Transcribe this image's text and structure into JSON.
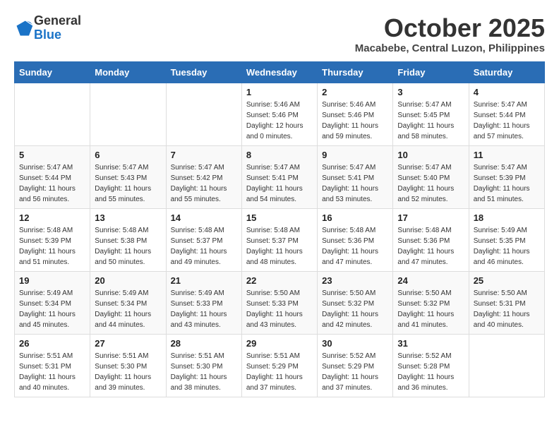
{
  "logo": {
    "general": "General",
    "blue": "Blue"
  },
  "title": "October 2025",
  "subtitle": "Macabebe, Central Luzon, Philippines",
  "weekdays": [
    "Sunday",
    "Monday",
    "Tuesday",
    "Wednesday",
    "Thursday",
    "Friday",
    "Saturday"
  ],
  "weeks": [
    [
      {
        "day": "",
        "info": ""
      },
      {
        "day": "",
        "info": ""
      },
      {
        "day": "",
        "info": ""
      },
      {
        "day": "1",
        "info": "Sunrise: 5:46 AM\nSunset: 5:46 PM\nDaylight: 12 hours\nand 0 minutes."
      },
      {
        "day": "2",
        "info": "Sunrise: 5:46 AM\nSunset: 5:46 PM\nDaylight: 11 hours\nand 59 minutes."
      },
      {
        "day": "3",
        "info": "Sunrise: 5:47 AM\nSunset: 5:45 PM\nDaylight: 11 hours\nand 58 minutes."
      },
      {
        "day": "4",
        "info": "Sunrise: 5:47 AM\nSunset: 5:44 PM\nDaylight: 11 hours\nand 57 minutes."
      }
    ],
    [
      {
        "day": "5",
        "info": "Sunrise: 5:47 AM\nSunset: 5:44 PM\nDaylight: 11 hours\nand 56 minutes."
      },
      {
        "day": "6",
        "info": "Sunrise: 5:47 AM\nSunset: 5:43 PM\nDaylight: 11 hours\nand 55 minutes."
      },
      {
        "day": "7",
        "info": "Sunrise: 5:47 AM\nSunset: 5:42 PM\nDaylight: 11 hours\nand 55 minutes."
      },
      {
        "day": "8",
        "info": "Sunrise: 5:47 AM\nSunset: 5:41 PM\nDaylight: 11 hours\nand 54 minutes."
      },
      {
        "day": "9",
        "info": "Sunrise: 5:47 AM\nSunset: 5:41 PM\nDaylight: 11 hours\nand 53 minutes."
      },
      {
        "day": "10",
        "info": "Sunrise: 5:47 AM\nSunset: 5:40 PM\nDaylight: 11 hours\nand 52 minutes."
      },
      {
        "day": "11",
        "info": "Sunrise: 5:47 AM\nSunset: 5:39 PM\nDaylight: 11 hours\nand 51 minutes."
      }
    ],
    [
      {
        "day": "12",
        "info": "Sunrise: 5:48 AM\nSunset: 5:39 PM\nDaylight: 11 hours\nand 51 minutes."
      },
      {
        "day": "13",
        "info": "Sunrise: 5:48 AM\nSunset: 5:38 PM\nDaylight: 11 hours\nand 50 minutes."
      },
      {
        "day": "14",
        "info": "Sunrise: 5:48 AM\nSunset: 5:37 PM\nDaylight: 11 hours\nand 49 minutes."
      },
      {
        "day": "15",
        "info": "Sunrise: 5:48 AM\nSunset: 5:37 PM\nDaylight: 11 hours\nand 48 minutes."
      },
      {
        "day": "16",
        "info": "Sunrise: 5:48 AM\nSunset: 5:36 PM\nDaylight: 11 hours\nand 47 minutes."
      },
      {
        "day": "17",
        "info": "Sunrise: 5:48 AM\nSunset: 5:36 PM\nDaylight: 11 hours\nand 47 minutes."
      },
      {
        "day": "18",
        "info": "Sunrise: 5:49 AM\nSunset: 5:35 PM\nDaylight: 11 hours\nand 46 minutes."
      }
    ],
    [
      {
        "day": "19",
        "info": "Sunrise: 5:49 AM\nSunset: 5:34 PM\nDaylight: 11 hours\nand 45 minutes."
      },
      {
        "day": "20",
        "info": "Sunrise: 5:49 AM\nSunset: 5:34 PM\nDaylight: 11 hours\nand 44 minutes."
      },
      {
        "day": "21",
        "info": "Sunrise: 5:49 AM\nSunset: 5:33 PM\nDaylight: 11 hours\nand 43 minutes."
      },
      {
        "day": "22",
        "info": "Sunrise: 5:50 AM\nSunset: 5:33 PM\nDaylight: 11 hours\nand 43 minutes."
      },
      {
        "day": "23",
        "info": "Sunrise: 5:50 AM\nSunset: 5:32 PM\nDaylight: 11 hours\nand 42 minutes."
      },
      {
        "day": "24",
        "info": "Sunrise: 5:50 AM\nSunset: 5:32 PM\nDaylight: 11 hours\nand 41 minutes."
      },
      {
        "day": "25",
        "info": "Sunrise: 5:50 AM\nSunset: 5:31 PM\nDaylight: 11 hours\nand 40 minutes."
      }
    ],
    [
      {
        "day": "26",
        "info": "Sunrise: 5:51 AM\nSunset: 5:31 PM\nDaylight: 11 hours\nand 40 minutes."
      },
      {
        "day": "27",
        "info": "Sunrise: 5:51 AM\nSunset: 5:30 PM\nDaylight: 11 hours\nand 39 minutes."
      },
      {
        "day": "28",
        "info": "Sunrise: 5:51 AM\nSunset: 5:30 PM\nDaylight: 11 hours\nand 38 minutes."
      },
      {
        "day": "29",
        "info": "Sunrise: 5:51 AM\nSunset: 5:29 PM\nDaylight: 11 hours\nand 37 minutes."
      },
      {
        "day": "30",
        "info": "Sunrise: 5:52 AM\nSunset: 5:29 PM\nDaylight: 11 hours\nand 37 minutes."
      },
      {
        "day": "31",
        "info": "Sunrise: 5:52 AM\nSunset: 5:28 PM\nDaylight: 11 hours\nand 36 minutes."
      },
      {
        "day": "",
        "info": ""
      }
    ]
  ]
}
